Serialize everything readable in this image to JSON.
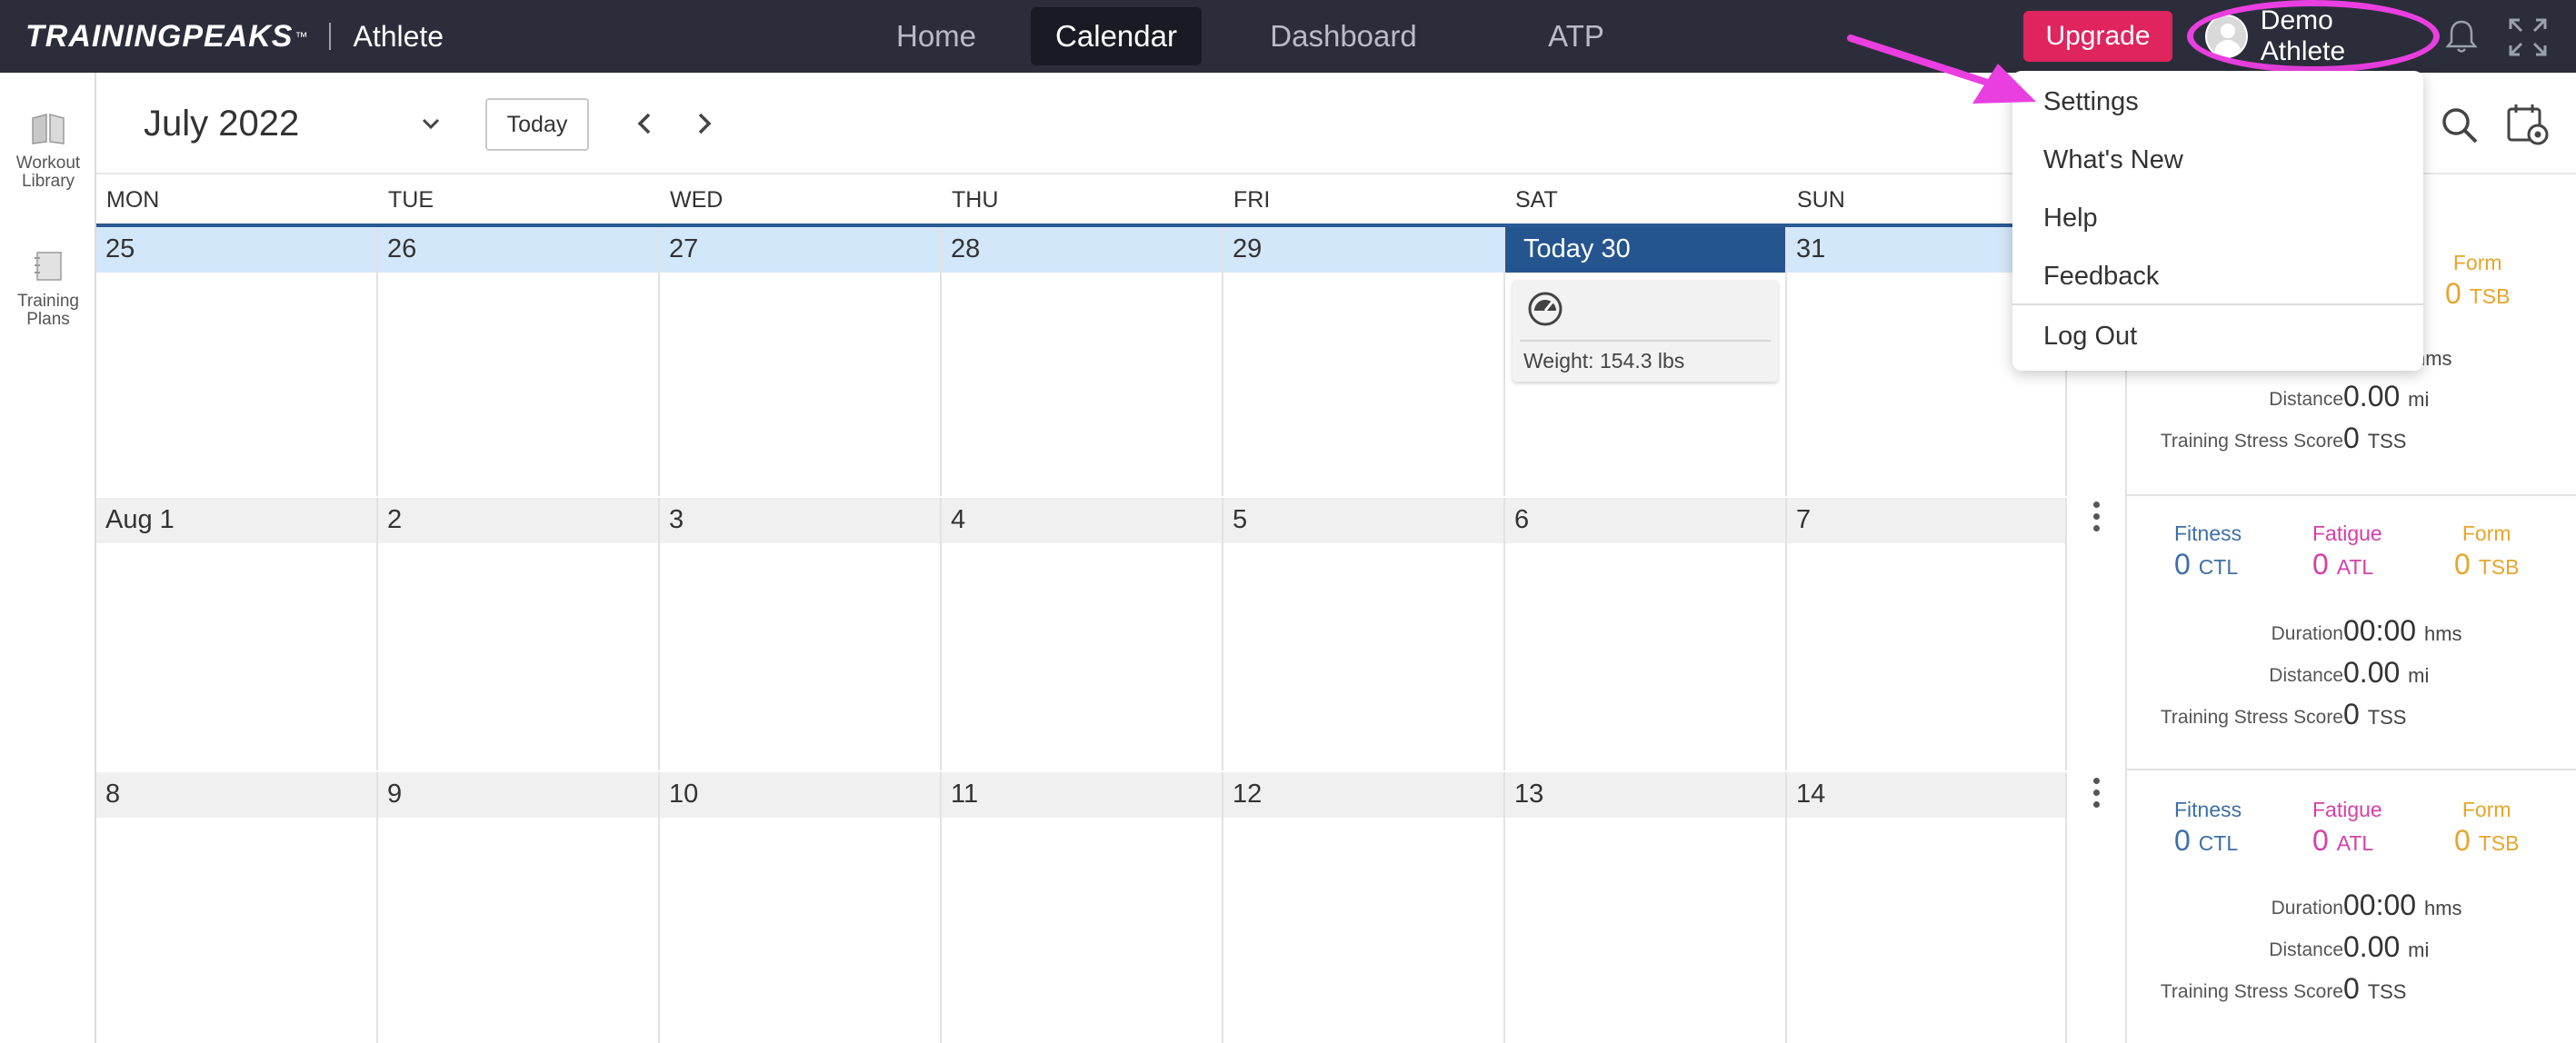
{
  "header": {
    "logo": "TRAININGPEAKS",
    "logo_tm": "™",
    "product": "Athlete",
    "nav_tabs": [
      "Home",
      "Calendar",
      "Dashboard",
      "ATP"
    ],
    "active_tab": "Calendar",
    "upgrade_label": "Upgrade",
    "user_name": "Demo Athlete"
  },
  "sidebar": {
    "items": [
      {
        "label_line1": "Workout",
        "label_line2": "Library",
        "icon": "book-icon"
      },
      {
        "label_line1": "Training",
        "label_line2": "Plans",
        "icon": "plans-icon"
      }
    ]
  },
  "toolbar": {
    "month_label": "July 2022",
    "today_label": "Today"
  },
  "weekdays": [
    "MON",
    "TUE",
    "WED",
    "THU",
    "FRI",
    "SAT",
    "SUN"
  ],
  "weeks": [
    {
      "days": [
        "25",
        "26",
        "27",
        "28",
        "29",
        "Today 30",
        "31"
      ]
    },
    {
      "days": [
        "Aug 1",
        "2",
        "3",
        "4",
        "5",
        "6",
        "7"
      ]
    },
    {
      "days": [
        "8",
        "9",
        "10",
        "11",
        "12",
        "13",
        "14"
      ]
    }
  ],
  "weight_card": {
    "text": "Weight: 154.3 lbs"
  },
  "summaries": [
    {
      "form_label": "Form",
      "form_value": "0",
      "form_unit": "TSB",
      "duration_partial": "hms",
      "distance_label": "Distance",
      "distance_value": "0.00",
      "distance_unit": "mi",
      "tss_label": "Training Stress Score",
      "tss_value": "0",
      "tss_unit": "TSS"
    },
    {
      "fitness_label": "Fitness",
      "fitness_value": "0",
      "fitness_unit": "CTL",
      "fatigue_label": "Fatigue",
      "fatigue_value": "0",
      "fatigue_unit": "ATL",
      "form_label": "Form",
      "form_value": "0",
      "form_unit": "TSB",
      "duration_label": "Duration",
      "duration_value": "00:00",
      "duration_unit": "hms",
      "distance_label": "Distance",
      "distance_value": "0.00",
      "distance_unit": "mi",
      "tss_label": "Training Stress Score",
      "tss_value": "0",
      "tss_unit": "TSS"
    },
    {
      "fitness_label": "Fitness",
      "fitness_value": "0",
      "fitness_unit": "CTL",
      "fatigue_label": "Fatigue",
      "fatigue_value": "0",
      "fatigue_unit": "ATL",
      "form_label": "Form",
      "form_value": "0",
      "form_unit": "TSB",
      "duration_label": "Duration",
      "duration_value": "00:00",
      "duration_unit": "hms",
      "distance_label": "Distance",
      "distance_value": "0.00",
      "distance_unit": "mi",
      "tss_label": "Training Stress Score",
      "tss_value": "0",
      "tss_unit": "TSS"
    }
  ],
  "user_menu": {
    "items": [
      "Settings",
      "What's New",
      "Help",
      "Feedback",
      "Log Out"
    ]
  },
  "colors": {
    "topbar": "#2b2e3a",
    "upgrade": "#e0245e",
    "today": "#25558f",
    "fitness": "#3d6ea8",
    "fatigue": "#d63fa7",
    "form": "#e6a52b",
    "annotation": "#ea3fe0"
  }
}
